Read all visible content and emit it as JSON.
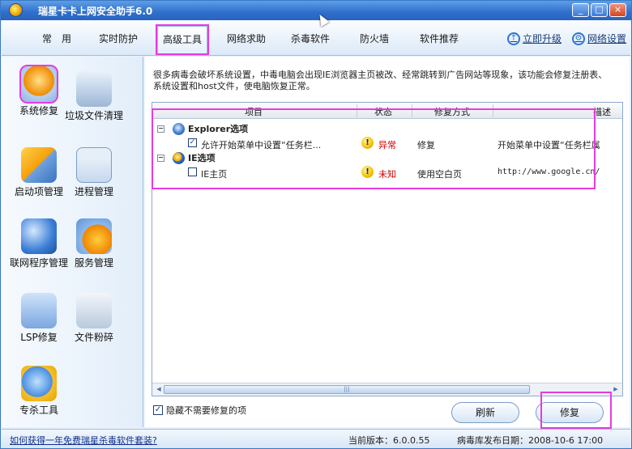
{
  "window": {
    "title": "瑞星卡卡上网安全助手6.0",
    "min": "_",
    "max": "□",
    "close": "×"
  },
  "nav": {
    "tabs": [
      {
        "label": "常　用"
      },
      {
        "label": "实时防护"
      },
      {
        "label": "高级工具"
      },
      {
        "label": "网络求助"
      },
      {
        "label": "杀毒软件"
      },
      {
        "label": "防火墙"
      },
      {
        "label": "软件推荐"
      }
    ],
    "upgrade_label": "立即升级",
    "netsettings_label": "网络设置"
  },
  "sidebar": {
    "items": [
      {
        "label": "系统修复",
        "icon": "system-repair-icon"
      },
      {
        "label": "垃圾文件清理",
        "icon": "trash-cleanup-icon"
      },
      {
        "label": "启动项管理",
        "icon": "startup-manager-icon"
      },
      {
        "label": "进程管理",
        "icon": "process-manager-icon"
      },
      {
        "label": "联网程序管理",
        "icon": "network-program-icon"
      },
      {
        "label": "服务管理",
        "icon": "service-manager-icon"
      },
      {
        "label": "LSP修复",
        "icon": "lsp-repair-icon"
      },
      {
        "label": "文件粉碎",
        "icon": "file-shredder-icon"
      },
      {
        "label": "专杀工具",
        "icon": "special-kill-icon"
      }
    ]
  },
  "main": {
    "description": "很多病毒会破坏系统设置，中毒电脑会出现IE浏览器主页被改、经常跳转到广告网站等现象，该功能会修复注册表、系统设置和host文件，使电脑恢复正常。",
    "columns": {
      "item": "项目",
      "status": "状态",
      "fix": "修复方式",
      "detail": "描述"
    },
    "groups": [
      {
        "name": "Explorer选项",
        "rows": [
          {
            "checked": "✓",
            "item": "允许开始菜单中设置“任务栏...",
            "status": "异常",
            "fix": "修复",
            "detail": "开始菜单中设置“任务栏属"
          }
        ]
      },
      {
        "name": "IE选项",
        "rows": [
          {
            "checked": "",
            "item": "IE主页",
            "status": "未知",
            "fix": "使用空白页",
            "detail": "http://www.google.cn/"
          }
        ]
      }
    ],
    "hide_unneeded_label": "隐藏不需要修复的项",
    "refresh_label": "刷新",
    "repair_label": "修复"
  },
  "statusbar": {
    "promo_link": "如何获得一年免费瑞星杀毒软件套装?",
    "version": "当前版本：6.0.0.55",
    "db_date": "病毒库发布日期：2008-10-6 17:00"
  }
}
